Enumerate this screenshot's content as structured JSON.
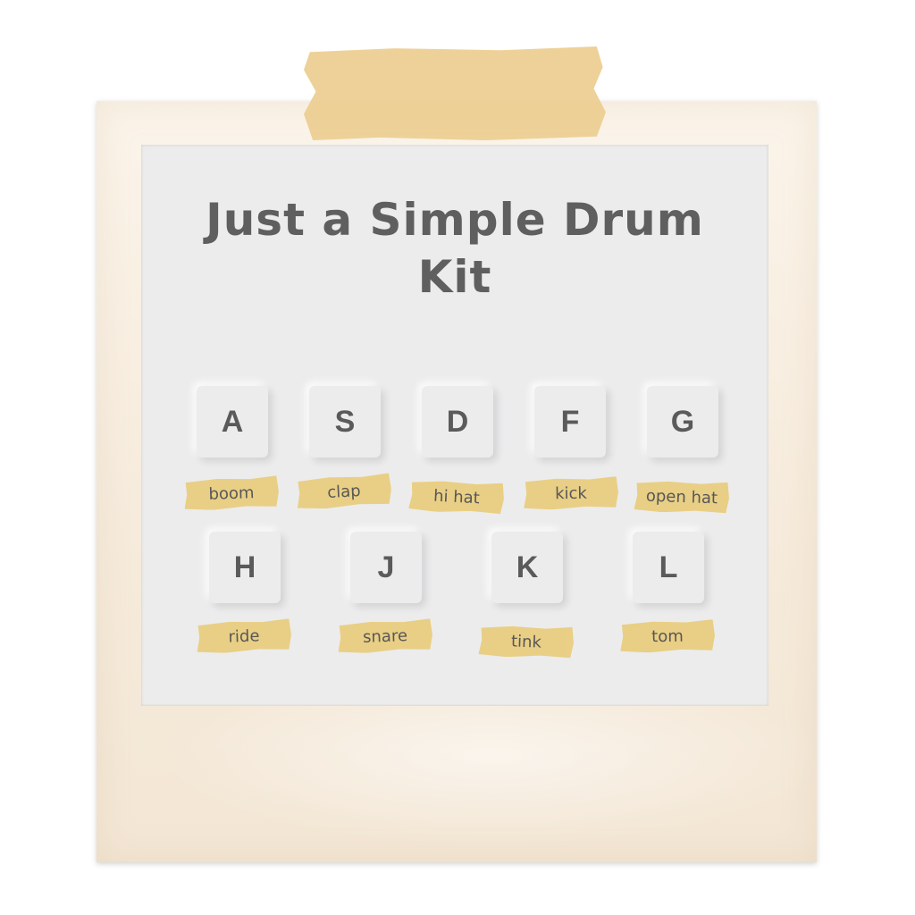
{
  "app": {
    "title_line1": "Just a Simple Drum",
    "title_line2": "Kit"
  },
  "keys": [
    {
      "key": "A",
      "sound": "boom"
    },
    {
      "key": "S",
      "sound": "clap"
    },
    {
      "key": "D",
      "sound": "hi hat"
    },
    {
      "key": "F",
      "sound": "kick"
    },
    {
      "key": "G",
      "sound": "open hat"
    },
    {
      "key": "H",
      "sound": "ride"
    },
    {
      "key": "J",
      "sound": "snare"
    },
    {
      "key": "K",
      "sound": "tink"
    },
    {
      "key": "L",
      "sound": "tom"
    }
  ],
  "colors": {
    "frame": "#f6ebdc",
    "tape": "#e9cc7c",
    "app_background": "#ececed",
    "text": "#5f5f5f"
  }
}
